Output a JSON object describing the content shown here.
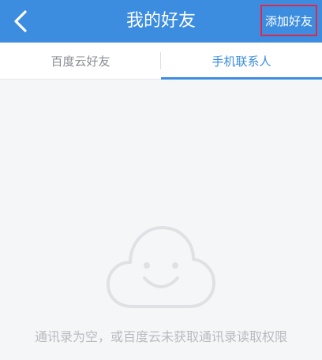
{
  "header": {
    "title": "我的好友",
    "add_friend_label": "添加好友",
    "back_icon": "chevron-left-icon",
    "background_color": "#3c8de0"
  },
  "tabs": [
    {
      "label": "百度云好友",
      "active": false
    },
    {
      "label": "手机联系人",
      "active": true
    }
  ],
  "empty_state": {
    "icon": "cloud-smile-icon",
    "message": "通讯录为空，或百度云未获取通讯录读取权限"
  },
  "colors": {
    "accent": "#3c8de0",
    "highlight_border": "#e0284a"
  }
}
